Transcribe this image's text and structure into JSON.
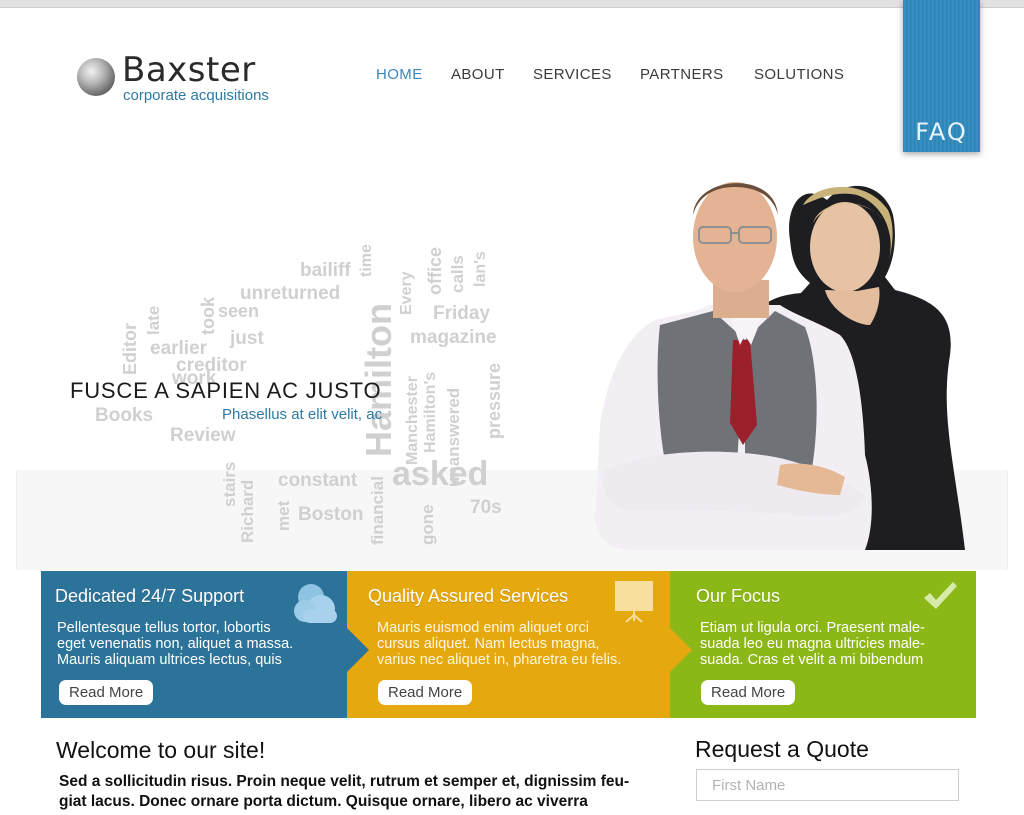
{
  "brand": {
    "name": "Baxster",
    "tagline": "corporate acquisitions"
  },
  "nav": {
    "items": [
      {
        "label": "HOME",
        "active": true
      },
      {
        "label": "ABOUT",
        "active": false
      },
      {
        "label": "SERVICES",
        "active": false
      },
      {
        "label": "PARTNERS",
        "active": false
      },
      {
        "label": "SOLUTIONS",
        "active": false
      }
    ]
  },
  "faq": {
    "label": "FAQ"
  },
  "hero": {
    "title": "FUSCE A SAPIEN AC JUSTO",
    "subtitle": "Phasellus at elit velit, ac",
    "word_cloud": [
      "bailiff",
      "time",
      "unreturned",
      "office",
      "calls",
      "lan's",
      "Every",
      "took",
      "seen",
      "Editor",
      "late",
      "just",
      "Friday",
      "earlier",
      "magazine",
      "creditor",
      "Hamilton",
      "Manchester",
      "Hamilton's",
      "unanswered",
      "pressure",
      "Books",
      "Review",
      "Richard",
      "stairs",
      "met",
      "constant",
      "financial",
      "asked",
      "gone",
      "70s",
      "Boston",
      "work"
    ]
  },
  "features": [
    {
      "title": "Dedicated 24/7 Support",
      "text": "Pellentesque tellus tortor, lobortis\neget venenatis non, aliquet a massa.\nMauris aliquam ultrices lectus, quis",
      "button": "Read More",
      "icon": "cloud-icon",
      "color": "#2c7399"
    },
    {
      "title": "Quality Assured Services",
      "text": "Mauris euismod enim aliquet orci\ncursus aliquet. Nam lectus magna,\nvarius nec aliquet in, pharetra eu felis.",
      "button": "Read More",
      "icon": "presentation-board-icon",
      "color": "#e6a80f"
    },
    {
      "title": "Our Focus",
      "text": "Etiam ut ligula orci. Praesent male-\nsuada leo eu magna ultricies male-\nsuada. Cras et velit a mi bibendum",
      "button": "Read More",
      "icon": "checkmark-icon",
      "color": "#8bb816"
    }
  ],
  "welcome": {
    "title": "Welcome to our site!",
    "text": "Sed a sollicitudin risus. Proin neque velit, rutrum et semper et, dignissim feu-\ngiat lacus. Donec ornare porta dictum. Quisque ornare, libero ac viverra"
  },
  "quote": {
    "title": "Request a Quote",
    "first_name_placeholder": "First Name"
  }
}
